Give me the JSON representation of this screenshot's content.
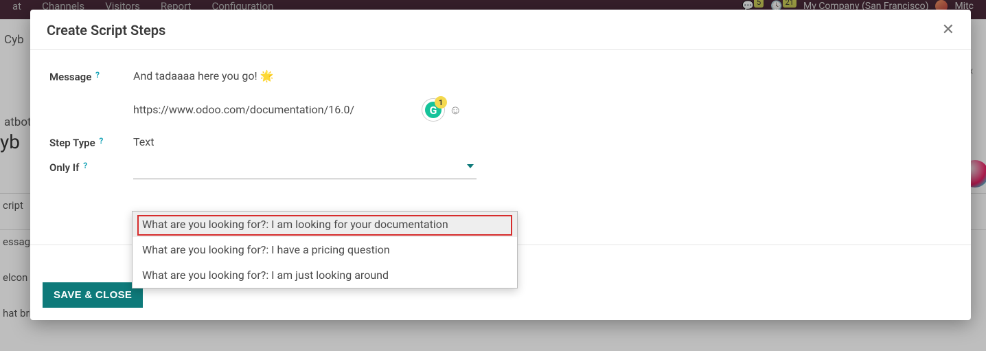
{
  "topnav": {
    "items": [
      "Channels",
      "Visitors",
      "Report",
      "Configuration"
    ],
    "chat_badge": "5",
    "activity_badge": "21",
    "company": "My Company (San Francisco)",
    "user_short": "Mitc"
  },
  "bg": {
    "breadcrumb_prefix": "at",
    "breadcrumb_cyb": "Cyb",
    "sidecut_atbot": "atbot",
    "sidecut_yb": "yb",
    "row_script": "cript",
    "row_essag": "essag",
    "row_elcon": "elcon",
    "row_what_brings": "hat brings you to our website!!!!!!"
  },
  "modal": {
    "title": "Create Script Steps",
    "labels": {
      "message": "Message",
      "step_type": "Step Type",
      "only_if": "Only If",
      "help": "?"
    },
    "message_line1": "And tadaaaa here you go! 🌟",
    "message_line2": "https://www.odoo.com/documentation/16.0/",
    "grammarly_count": "1",
    "step_type_value": "Text",
    "only_if_value": "",
    "dropdown": {
      "opt0": "What are you looking for?: I am looking for your documentation",
      "opt1": "What are you looking for?: I have a pricing question",
      "opt2": "What are you looking for?: I am just looking around"
    },
    "save_label": "SAVE & CLOSE"
  }
}
